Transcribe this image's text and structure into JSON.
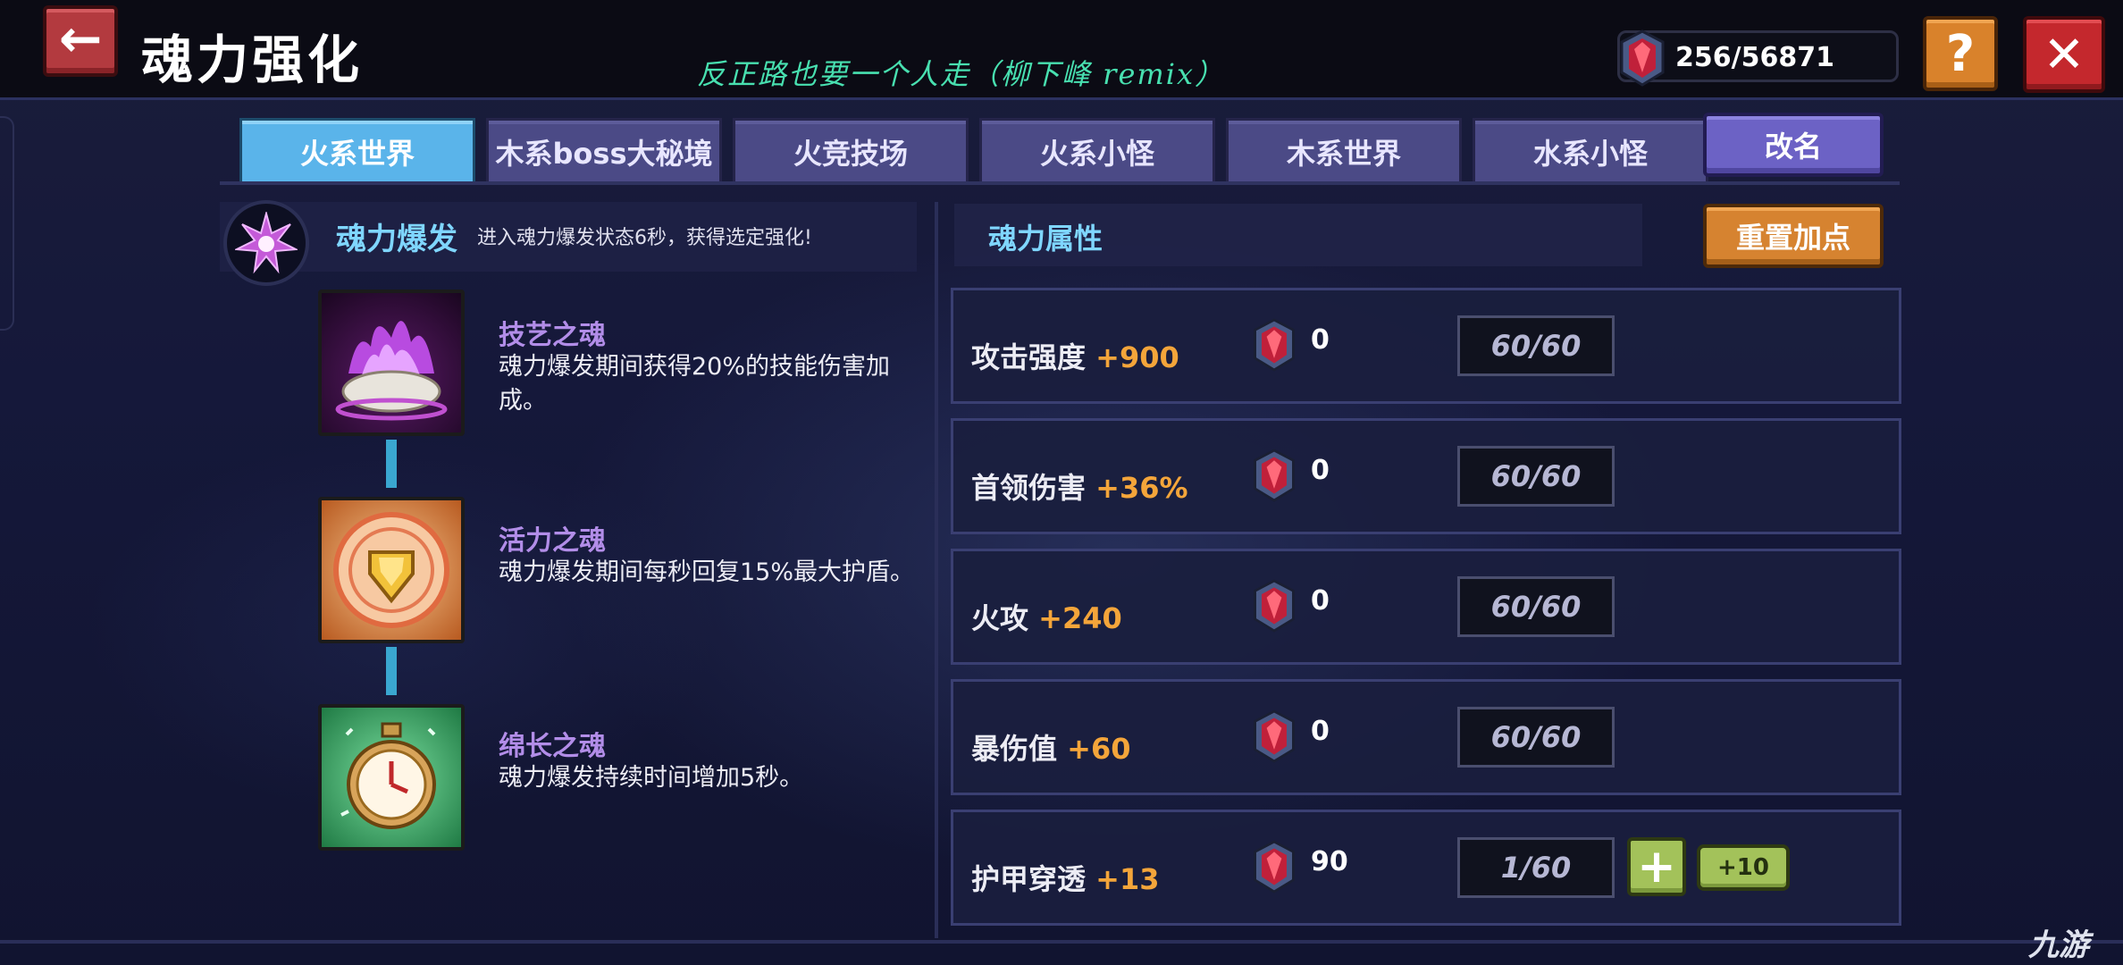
{
  "header": {
    "title": "魂力强化",
    "song_overlay": "反正路也要一个人走（柳下峰 remix）",
    "currency": "256/56871",
    "help_label": "?",
    "close_label": "✕",
    "back_label": "←"
  },
  "tabs": [
    {
      "label": "火系世界",
      "active": true
    },
    {
      "label": "木系boss大秘境",
      "active": false
    },
    {
      "label": "火竞技场",
      "active": false
    },
    {
      "label": "火系小怪",
      "active": false
    },
    {
      "label": "木系世界",
      "active": false
    },
    {
      "label": "水系小怪",
      "active": false
    }
  ],
  "rename_label": "改名",
  "burst": {
    "title": "魂力爆发",
    "desc": "进入魂力爆发状态6秒，获得选定强化!"
  },
  "skills": [
    {
      "name": "技艺之魂",
      "desc": "魂力爆发期间获得20%的技能伤害加成。",
      "icon": "purple-flame-icon"
    },
    {
      "name": "活力之魂",
      "desc": "魂力爆发期间每秒回复15%最大护盾。",
      "icon": "shield-emblem-icon"
    },
    {
      "name": "绵长之魂",
      "desc": "魂力爆发持续时间增加5秒。",
      "icon": "stopwatch-icon"
    }
  ],
  "attributes": {
    "title": "魂力属性",
    "reset_label": "重置加点",
    "rows": [
      {
        "name": "攻击强度",
        "bonus": "+900",
        "count": "0",
        "progress": "60/60"
      },
      {
        "name": "首领伤害",
        "bonus": "+36%",
        "count": "0",
        "progress": "60/60"
      },
      {
        "name": "火攻",
        "bonus": "+240",
        "count": "0",
        "progress": "60/60"
      },
      {
        "name": "暴伤值",
        "bonus": "+60",
        "count": "0",
        "progress": "60/60"
      },
      {
        "name": "护甲穿透",
        "bonus": "+13",
        "count": "90",
        "progress": "1/60",
        "plus_label": "+",
        "plus10_label": "+10"
      }
    ]
  },
  "watermark": "九游",
  "colors": {
    "active_tab": "#5ab4ea",
    "tab": "#4b4a86",
    "bonus": "#f4a53a",
    "section_title": "#7fd6ff",
    "skill_name": "#b28de8"
  }
}
